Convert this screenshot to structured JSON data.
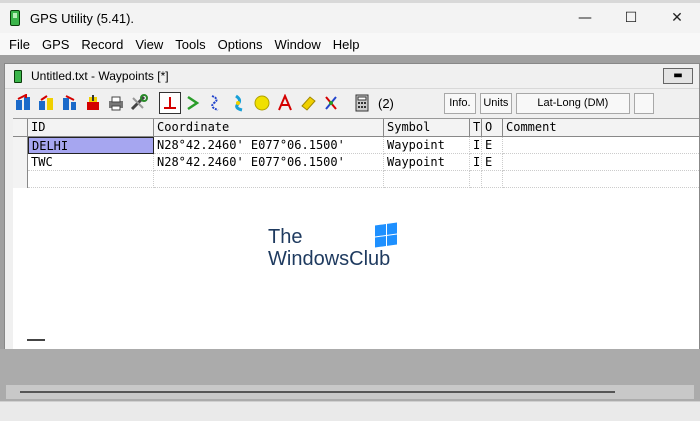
{
  "app": {
    "title": "GPS Utility (5.41)."
  },
  "window_controls": {
    "minimize": "—",
    "maximize": "☐",
    "close": "✕"
  },
  "menu": [
    "File",
    "GPS",
    "Record",
    "View",
    "Tools",
    "Options",
    "Window",
    "Help"
  ],
  "child_window": {
    "title": "Untitled.txt - Waypoints [*]",
    "minimize_glyph": "▬"
  },
  "toolbar": {
    "count": "(2)",
    "info_label": "Info.",
    "units_label": "Units",
    "format_label": "Lat-Long (DM)",
    "icons": [
      "open-gps-icon",
      "upload-icon",
      "transfer-icon",
      "download-icon",
      "print-icon",
      "tools-icon",
      "waypoint-icon",
      "route-icon",
      "track-icon",
      "map-icon",
      "circle-icon",
      "text-icon",
      "edit-icon",
      "link-icon",
      "calculator-icon"
    ]
  },
  "grid": {
    "columns": [
      "ID",
      "Coordinate",
      "Symbol",
      "T",
      "O",
      "Comment"
    ],
    "rows": [
      {
        "id": "DELHI",
        "coordinate": "N28°42.2460' E077°06.1500'",
        "symbol": "Waypoint",
        "t": "I",
        "o": "E",
        "comment": ""
      },
      {
        "id": "TWC",
        "coordinate": "N28°42.2460' E077°06.1500'",
        "symbol": "Waypoint",
        "t": "I",
        "o": "E",
        "comment": ""
      }
    ]
  },
  "watermark": {
    "line1": "The",
    "line2": "WindowsClub"
  },
  "colors": {
    "selection": "#a6a6f0",
    "mdi_background": "#a0a0a0",
    "logo_blue": "#1e90ff"
  }
}
